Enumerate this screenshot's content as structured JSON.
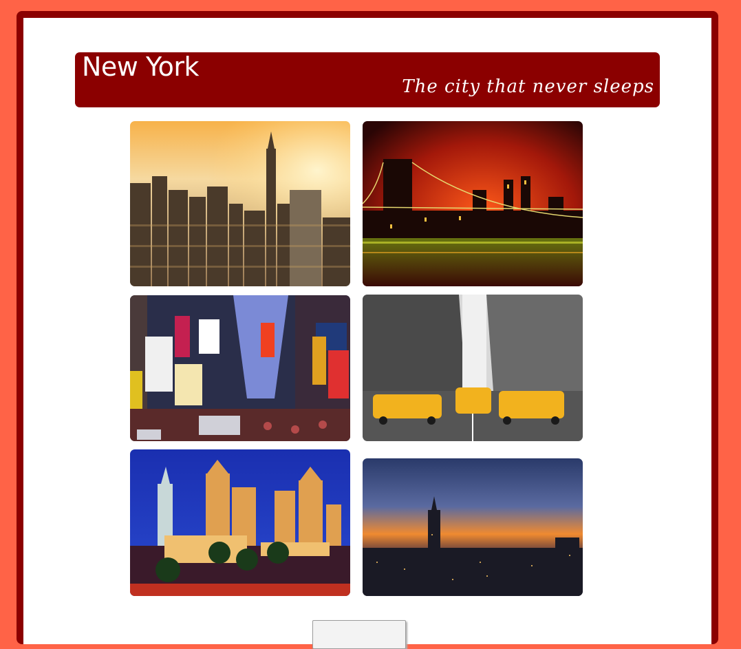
{
  "header": {
    "title": "New York",
    "subtitle": "The city that never sleeps"
  },
  "colors": {
    "background": "#ff6347",
    "frame": "#8b0000",
    "header_bg": "#8b0000",
    "header_text": "#ffffff"
  },
  "gallery": {
    "photos": [
      {
        "subject": "Manhattan skyline at sunset with Empire State Building"
      },
      {
        "subject": "Brooklyn Bridge at night over water"
      },
      {
        "subject": "Times Square billboards and crowds at dusk"
      },
      {
        "subject": "Yellow taxi cabs on a black-and-white street"
      },
      {
        "subject": "New York-New York hotel with Statue of Liberty replica"
      },
      {
        "subject": "Manhattan skyline at dusk from above"
      }
    ]
  },
  "footer": {
    "button_label": ""
  }
}
